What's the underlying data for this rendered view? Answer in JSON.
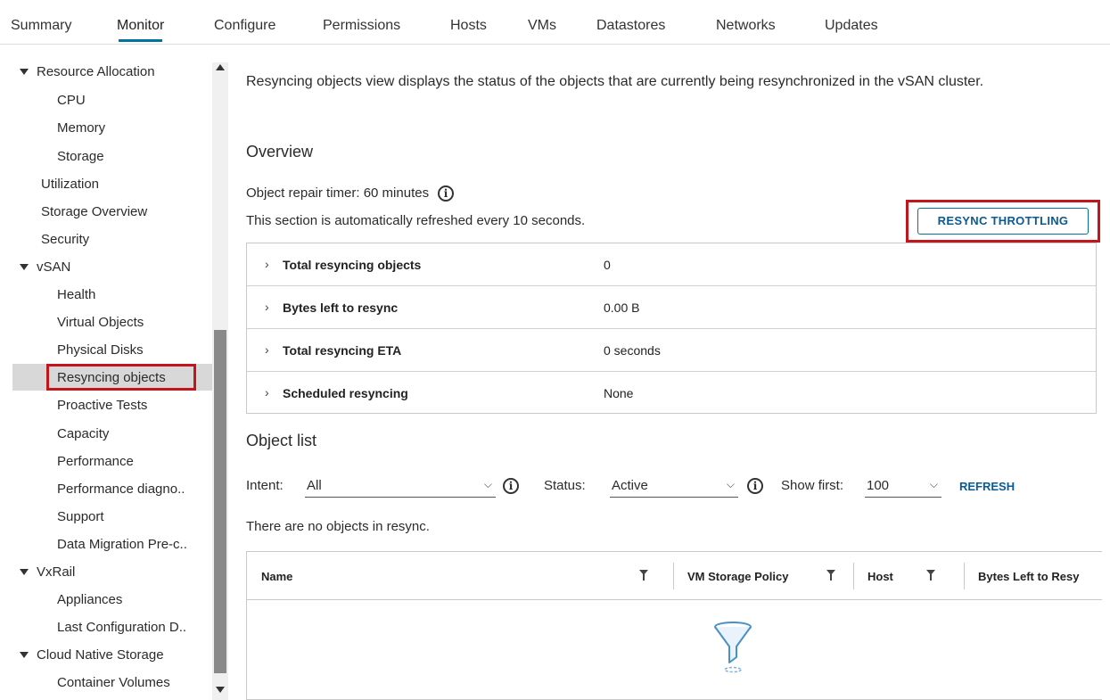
{
  "tabs": [
    "Summary",
    "Monitor",
    "Configure",
    "Permissions",
    "Hosts",
    "VMs",
    "Datastores",
    "Networks",
    "Updates"
  ],
  "active_tab": "Monitor",
  "sidebar": {
    "items": [
      {
        "label": "Resource Allocation",
        "level": 0,
        "expanded": true
      },
      {
        "label": "CPU",
        "level": 1
      },
      {
        "label": "Memory",
        "level": 1
      },
      {
        "label": "Storage",
        "level": 1
      },
      {
        "label": "Utilization",
        "level": 0
      },
      {
        "label": "Storage Overview",
        "level": 0
      },
      {
        "label": "Security",
        "level": 0
      },
      {
        "label": "vSAN",
        "level": 0,
        "expanded": true
      },
      {
        "label": "Health",
        "level": 1
      },
      {
        "label": "Virtual Objects",
        "level": 1
      },
      {
        "label": "Physical Disks",
        "level": 1
      },
      {
        "label": "Resyncing objects",
        "level": 1,
        "selected": true
      },
      {
        "label": "Proactive Tests",
        "level": 1
      },
      {
        "label": "Capacity",
        "level": 1
      },
      {
        "label": "Performance",
        "level": 1
      },
      {
        "label": "Performance diagno..",
        "level": 1
      },
      {
        "label": "Support",
        "level": 1
      },
      {
        "label": "Data Migration Pre-c..",
        "level": 1
      },
      {
        "label": "VxRail",
        "level": 0,
        "expanded": true
      },
      {
        "label": "Appliances",
        "level": 1
      },
      {
        "label": "Last Configuration D..",
        "level": 1
      },
      {
        "label": "Cloud Native Storage",
        "level": 0,
        "expanded": true
      },
      {
        "label": "Container Volumes",
        "level": 1
      }
    ]
  },
  "main": {
    "description": "Resyncing objects view displays the status of the objects that are currently being resynchronized in the vSAN cluster.",
    "overview_title": "Overview",
    "repair_timer": "Object repair timer: 60 minutes",
    "refresh_note": "This section is automatically refreshed every 10 seconds.",
    "throttle_button": "RESYNC THROTTLING",
    "overview_rows": [
      {
        "label": "Total resyncing objects",
        "value": "0"
      },
      {
        "label": "Bytes left to resync",
        "value": "0.00 B"
      },
      {
        "label": "Total resyncing ETA",
        "value": "0 seconds"
      },
      {
        "label": "Scheduled resyncing",
        "value": "None"
      }
    ],
    "list_title": "Object list",
    "filters": {
      "intent_label": "Intent:",
      "intent_value": "All",
      "status_label": "Status:",
      "status_value": "Active",
      "show_first_label": "Show first:",
      "show_first_value": "100",
      "refresh": "REFRESH"
    },
    "empty_message": "There are no objects in resync.",
    "columns": [
      "Name",
      "VM Storage Policy",
      "Host",
      "Bytes Left to Resy"
    ]
  },
  "colors": {
    "accent": "#0072a3",
    "highlight": "#c0161c",
    "link": "#0a5a94"
  }
}
